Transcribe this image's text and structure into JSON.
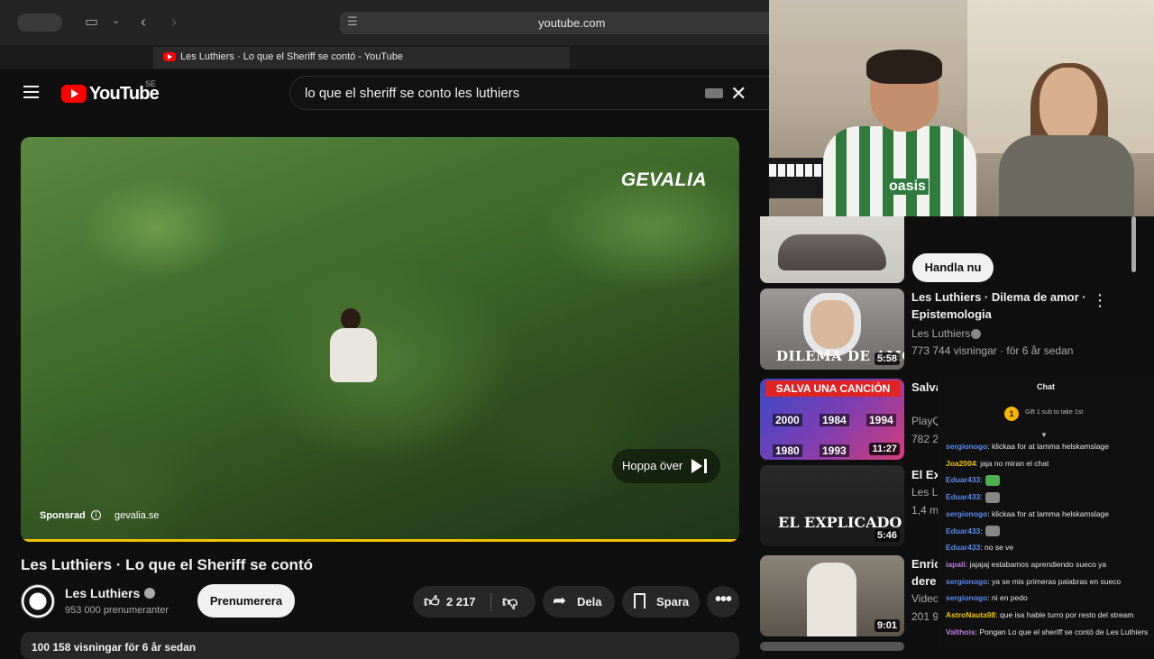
{
  "browser": {
    "url": "youtube.com",
    "tab_title": "Les Luthiers · Lo que el Sheriff se contó - YouTube"
  },
  "header": {
    "logo_text": "YouTube",
    "region": "SE",
    "search_value": "lo que el sheriff se conto les luthiers"
  },
  "video": {
    "ad_brand": "GEVALIA",
    "skip_label": "Hoppa över",
    "sponsored_label": "Sponsrad",
    "ad_domain": "gevalia.se",
    "title": "Les Luthiers · Lo que el Sheriff se contó",
    "channel_name": "Les Luthiers",
    "subscribers": "953 000 prenumeranter",
    "subscribe_label": "Prenumerera",
    "like_count": "2 217",
    "share_label": "Dela",
    "save_label": "Spara",
    "views_text": "100 158 visningar  för 6 år sedan",
    "progress_fraction": 1.0,
    "progress_color": "#f2c300"
  },
  "recommendations": {
    "shop_label": "Handla nu",
    "items": [
      {
        "title_line1": "Les Luthiers · Dilema de amor ·",
        "title_line2": "Epistemologia",
        "channel": "Les Luthiers",
        "meta": "773 744 visningar · för 6 år sedan",
        "duration": "5:58",
        "thumb_caption": "DILEMA DE AMOR"
      },
      {
        "title_line1": "Salva",
        "channel": "PlayQ",
        "meta": "782 2",
        "duration": "11:27",
        "thumb_caption": "SALVA UNA CANCIÓN",
        "years": [
          "2000",
          "1984",
          "1994",
          "1980",
          "1993"
        ]
      },
      {
        "title_line1": "El Ex",
        "channel": "Les L",
        "meta": "1,4 m",
        "duration": "5:46",
        "thumb_caption": "EL EXPLICADO"
      },
      {
        "title_line1": "Enric",
        "title_line2": "dere",
        "channel": "Video",
        "meta": "201 9",
        "duration": "9:01"
      }
    ]
  },
  "webcam": {
    "shirt_text": "oasis"
  },
  "chat": {
    "header": "Chat",
    "gift_text": "Gift 1 sub to take 1st",
    "gift_count": "1",
    "messages": [
      {
        "user": "sergionogo",
        "color": "#5b8def",
        "text": ": klickaa for at lamma helskamslage"
      },
      {
        "user": "Joa2004",
        "color": "#f2c300",
        "text": ": jaja no miran el chat"
      },
      {
        "user": "Eduar433",
        "color": "#5b8def",
        "text": ":",
        "emote": "#4caf50"
      },
      {
        "user": "Eduar433",
        "color": "#5b8def",
        "text": ":",
        "emote": "#888888"
      },
      {
        "user": "sergionogo",
        "color": "#5b8def",
        "text": ": klickaa for at lamma helskamslage"
      },
      {
        "user": "Eduar433",
        "color": "#5b8def",
        "text": ":",
        "emote": "#888888"
      },
      {
        "user": "Eduar433",
        "color": "#5b8def",
        "text": ": no se ve"
      },
      {
        "user": "iapali",
        "color": "#c07ee8",
        "text": ": jajajaj estabamos aprendiendo sueco ya"
      },
      {
        "user": "sergionogo",
        "color": "#5b8def",
        "text": ": ya se mis primeras palabras en sueco"
      },
      {
        "user": "sergionogo",
        "color": "#5b8def",
        "text": ": ni en pedo"
      },
      {
        "user": "AstroNauta98",
        "color": "#f2c300",
        "text": ": que isa hable turro por resto del stream"
      },
      {
        "user": "Valthois",
        "color": "#c07ee8",
        "text": ": Pongan Lo que el sheriff se contó de Les Luthiers"
      }
    ]
  }
}
